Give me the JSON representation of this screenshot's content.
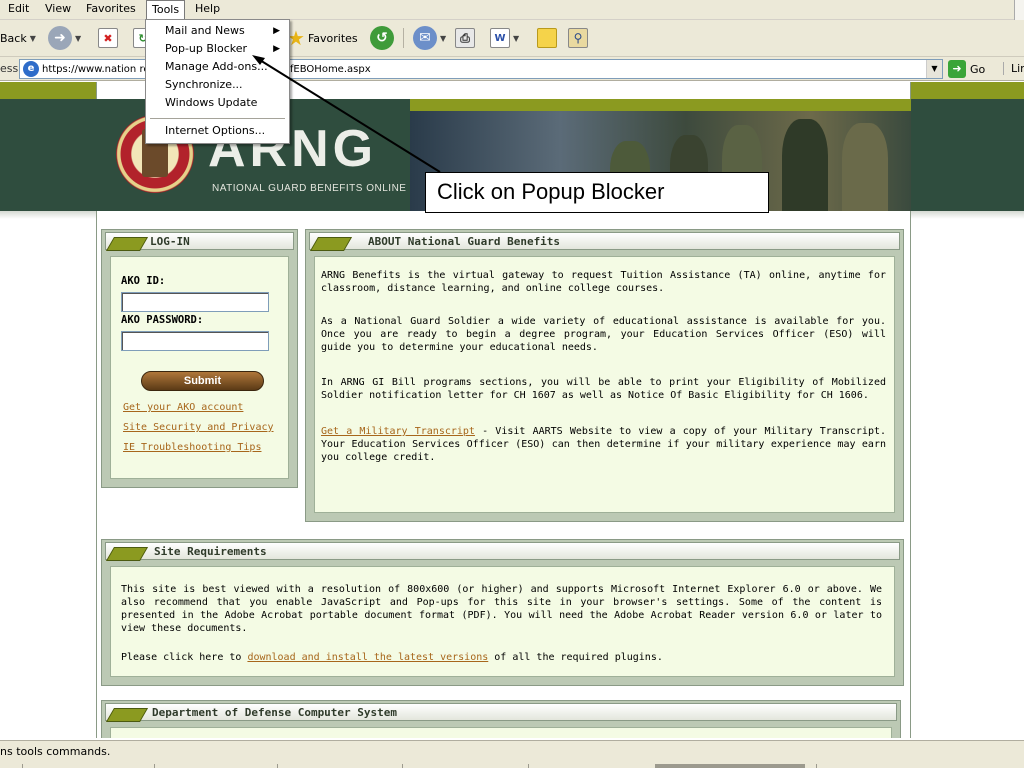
{
  "menubar": {
    "items": [
      "Edit",
      "View",
      "Favorites",
      "Tools",
      "Help"
    ]
  },
  "toolbar": {
    "back_label": "Back",
    "favorites_label": "Favorites"
  },
  "address_bar": {
    "label": "ess",
    "url": "https://www.nation                              red/Login.aspx?ReturnUrl=%2fEBOHome.aspx",
    "go_label": "Go",
    "links_label": "Lin"
  },
  "tools_menu": {
    "items": [
      {
        "label": "Mail and News",
        "has_submenu": true
      },
      {
        "label": "Pop-up Blocker",
        "has_submenu": true
      },
      {
        "label": "Manage Add-ons...",
        "has_submenu": false
      },
      {
        "label": "Synchronize...",
        "has_submenu": false
      },
      {
        "label": "Windows Update",
        "has_submenu": false
      },
      {
        "label": "Internet Options...",
        "has_submenu": false
      }
    ]
  },
  "callout": {
    "text": "Click on Popup Blocker"
  },
  "site_header": {
    "brand": "ARNG",
    "subtitle": "NATIONAL GUARD BENEFITS ONLINE"
  },
  "login": {
    "title": "LOG-IN",
    "ako_id_label": "AKO ID:",
    "ako_password_label": "AKO PASSWORD:",
    "submit_label": "Submit",
    "links": [
      "Get your AKO account",
      "Site Security and Privacy",
      "IE Troubleshooting Tips"
    ]
  },
  "about": {
    "title": "ABOUT National Guard Benefits",
    "p1": "ARNG Benefits is the virtual gateway to request Tuition Assistance (TA) online, anytime for classroom, distance learning, and online college courses.",
    "p2": "As a National Guard Soldier a wide variety of educational assistance is available for you. Once you are ready to begin a degree program, your Education Services Officer (ESO) will guide you to determine your educational needs.",
    "p3": "In ARNG GI Bill programs sections, you will be able to print your Eligibility of Mobilized Soldier notification letter for CH 1607 as well as Notice Of Basic Eligibility for CH 1606.",
    "p4_link": "Get a Military Transcript",
    "p4_rest": " - Visit AARTS Website to view a copy of your Military Transcript. Your Education Services Officer (ESO) can then determine if your military experience may earn you college credit."
  },
  "site_requirements": {
    "title": "Site Requirements",
    "p1": "This site is best viewed with a resolution of 800x600 (or higher) and supports Microsoft Internet Explorer 6.0 or above. We also recommend that you enable JavaScript and Pop-ups for this site in your browser's settings. Some of the content is presented in the Adobe Acrobat portable document format (PDF). You will need the Adobe Acrobat Reader version 6.0 or later to view these documents.",
    "p2_before": "Please click here to ",
    "p2_link": "download and install the latest versions",
    "p2_after": " of all the required plugins."
  },
  "dod": {
    "title": "Department of Defense Computer System"
  },
  "statusbar": {
    "text": "ns tools commands."
  }
}
